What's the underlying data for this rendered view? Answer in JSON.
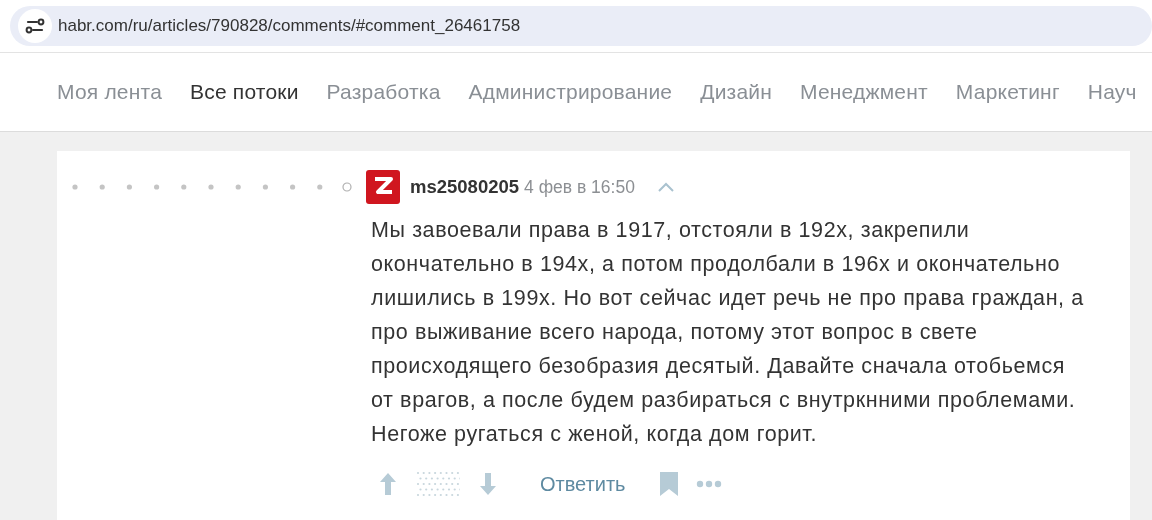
{
  "address_bar": {
    "url": "habr.com/ru/articles/790828/comments/#comment_26461758"
  },
  "nav_tabs": [
    {
      "label": "Моя лента",
      "selected": false
    },
    {
      "label": "Все потоки",
      "selected": true
    },
    {
      "label": "Разработка",
      "selected": false
    },
    {
      "label": "Администрирование",
      "selected": false
    },
    {
      "label": "Дизайн",
      "selected": false
    },
    {
      "label": "Менеджмент",
      "selected": false
    },
    {
      "label": "Маркетинг",
      "selected": false
    },
    {
      "label": "Науч",
      "selected": false
    }
  ],
  "comment": {
    "author": "ms25080205",
    "time": "4 фев в 16:50",
    "body_lines": [
      "Мы завоевали права в 1917, отстояли в 192х, закрепили",
      "окончательно в 194х, а потом продолбали в 196х и окончательно",
      "лишились в 199х. Но вот сейчас идет речь не про права граждан, а",
      "про выживание всего народа, потому этот вопрос в свете",
      "происходящего безобразия десятый. Давайте сначала отобьемся",
      "от врагов, а после будем разбираться с внутркнними проблемами.",
      "Негоже ругаться с женой, когда дом горит."
    ],
    "reply_label": "Ответить"
  }
}
